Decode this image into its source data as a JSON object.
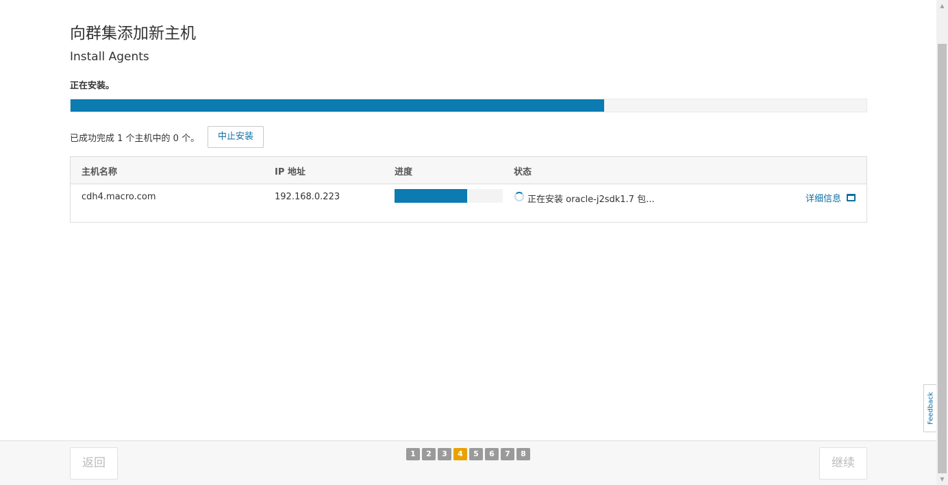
{
  "page": {
    "title": "向群集添加新主机",
    "subtitle": "Install Agents",
    "status": "正在安装。",
    "overall_progress_percent": 67
  },
  "summary": {
    "text": "已成功完成 1 个主机中的 0 个。",
    "abort_label": "中止安装"
  },
  "table": {
    "headers": [
      "主机名称",
      "IP 地址",
      "进度",
      "状态"
    ],
    "rows": [
      {
        "hostname": "cdh4.macro.com",
        "ip": "192.168.0.223",
        "progress_percent": 67,
        "status": "正在安装 oracle-j2sdk1.7 包...",
        "details_label": "详细信息"
      }
    ]
  },
  "footer": {
    "back_label": "返回",
    "continue_label": "继续",
    "steps": [
      "1",
      "2",
      "3",
      "4",
      "5",
      "6",
      "7",
      "8"
    ],
    "active_step": 4
  },
  "feedback_label": "Feedback",
  "icons": {
    "spinner": "loading-spinner-icon",
    "details": "window-icon"
  },
  "colors": {
    "accent": "#0b7bb1",
    "link": "#0b6fa4",
    "active_step": "#e8a200",
    "inactive_step": "#9a9a9a"
  }
}
